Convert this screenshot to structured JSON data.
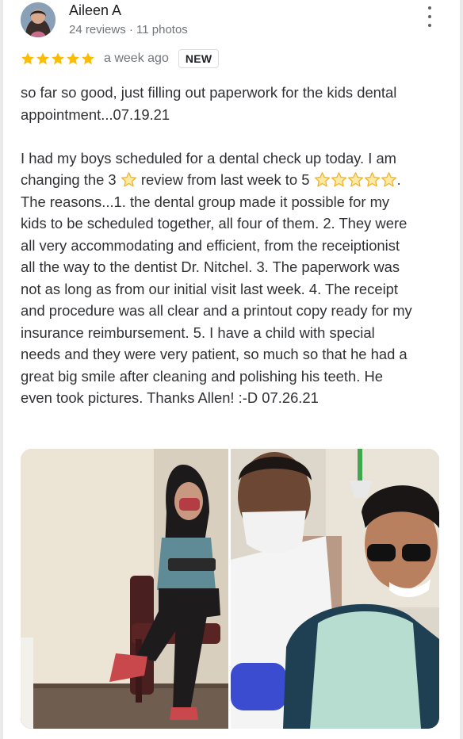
{
  "review": {
    "author": "Aileen A",
    "author_meta": "24 reviews · 11 photos",
    "rating": 5,
    "time": "a week ago",
    "badge": "NEW",
    "text_1": "so far so good, just filling out paperwork for the kids dental appointment...07.19.21",
    "text_2a": "I had my boys scheduled for a dental check up today. I am changing the 3 ",
    "text_2b": " review from last week to 5 ",
    "text_2c": ". The reasons...1. the dental group made it possible for my kids to be scheduled together, all four of them.  2. They were all very accommodating and efficient, from the receiptionist all the way to the dentist Dr. Nitchel.  3. The paperwork was not as long as from our initial visit last week. 4. The receipt and procedure was all clear and a printout copy ready for my insurance reimbursement. 5. I have a child with special needs and they were very patient, so much so that he had a great big smile after cleaning and polishing his teeth. He even took pictures. Thanks Allen! :-D 07.26.21"
  },
  "colors": {
    "star": "#fbbc04",
    "inline_star_fill": "#fde9a6",
    "inline_star_stroke": "#f2b01e"
  },
  "icons": {
    "more": "more-vert-icon",
    "star": "star-icon"
  }
}
